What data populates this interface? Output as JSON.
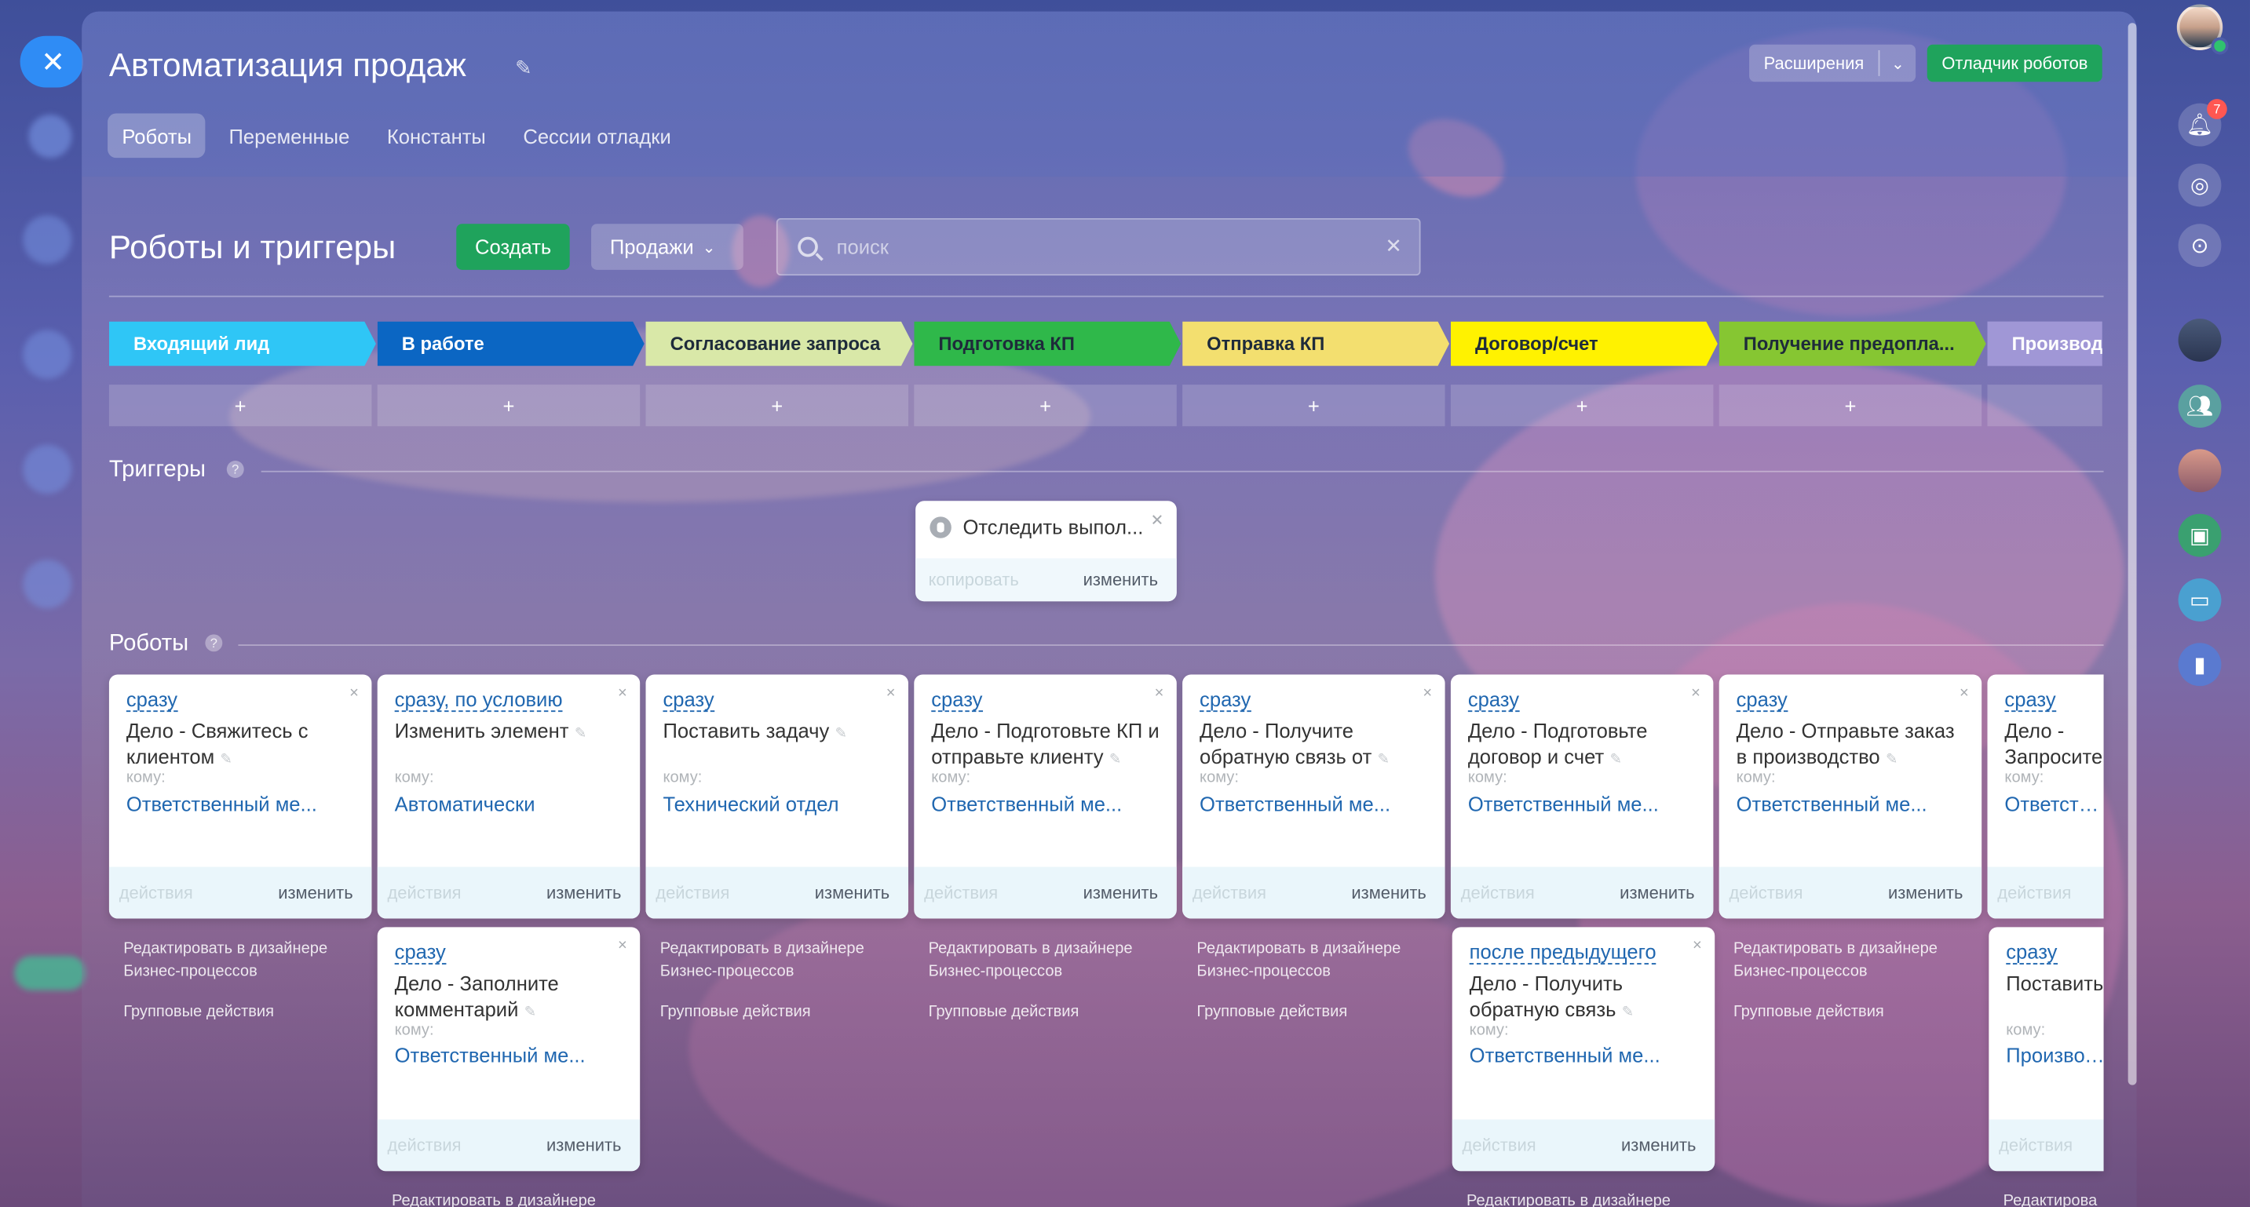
{
  "page": {
    "title": "Автоматизация продаж"
  },
  "header": {
    "extensions_label": "Расширения",
    "debugger_label": "Отладчик роботов"
  },
  "tabs": [
    {
      "label": "Роботы",
      "active": true
    },
    {
      "label": "Переменные"
    },
    {
      "label": "Константы"
    },
    {
      "label": "Сессии отладки"
    }
  ],
  "section": {
    "title": "Роботы и триггеры",
    "create_label": "Создать",
    "funnel_label": "Продажи",
    "search_placeholder": "поиск"
  },
  "stages": [
    {
      "label": "Входящий лид",
      "color": "#2fc6f6"
    },
    {
      "label": "В работе",
      "color": "#0b66c3"
    },
    {
      "label": "Согласование запроса",
      "color": "#d9e8a8"
    },
    {
      "label": "Подготовка КП",
      "color": "#2fb84a"
    },
    {
      "label": "Отправка КП",
      "color": "#f3df6f"
    },
    {
      "label": "Договор/счет",
      "color": "#fff200"
    },
    {
      "label": "Получение предопла...",
      "color": "#86c632"
    },
    {
      "label": "Производство",
      "color": "#a097d6"
    }
  ],
  "add_label": "+",
  "triggers": {
    "title": "Триггеры",
    "help": "?",
    "card": {
      "title": "Отследить выпол...",
      "copy_label": "копировать",
      "edit_label": "изменить"
    }
  },
  "robots": {
    "title": "Роботы",
    "help": "?"
  },
  "card_labels": {
    "to": "кому:",
    "actions": "действия",
    "edit": "изменить",
    "close": "×",
    "bp_link": "Редактировать в дизайнере Бизнес-процессов",
    "bp_link_cut": "Редактирова",
    "group_actions": "Групповые действия"
  },
  "robot_cards": [
    {
      "cond": "сразу",
      "title": "Дело - Свяжитесь с клиентом",
      "resp": "Ответственный ме..."
    },
    {
      "cond": "сразу, по условию",
      "title": "Изменить элемент",
      "resp": "Автоматически"
    },
    {
      "cond": "сразу",
      "title": "Поставить задачу",
      "resp": "Технический отдел"
    },
    {
      "cond": "сразу",
      "title": "Дело - Подготовьте КП и отправьте клиенту",
      "resp": "Ответственный ме..."
    },
    {
      "cond": "сразу",
      "title": "Дело - Получите обратную связь от",
      "resp": "Ответственный ме..."
    },
    {
      "cond": "сразу",
      "title": "Дело - Подготовьте договор и счет",
      "resp": "Ответственный ме..."
    },
    {
      "cond": "сразу",
      "title": "Дело - Отправьте заказ в производство",
      "resp": "Ответственный ме..."
    },
    {
      "cond": "сразу",
      "title": "Дело - Запросите смарт-процесс",
      "resp": "Ответственный ме..."
    }
  ],
  "robot_cards_row2": [
    {
      "cond": "сразу",
      "title": "Дело - Заполните комментарий",
      "resp": "Ответственный ме..."
    },
    {
      "cond": "после предыдущего",
      "title": "Дело - Получить обратную связь",
      "resp": "Ответственный ме..."
    },
    {
      "cond": "сразу",
      "title": "Поставить задачу",
      "resp": "Производство"
    }
  ],
  "sidebar": {
    "notifications_count": "7"
  }
}
